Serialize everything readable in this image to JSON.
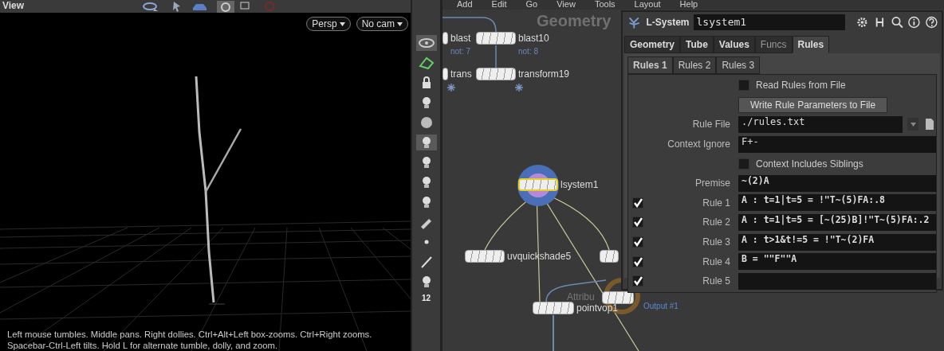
{
  "viewer": {
    "title": "View",
    "camera_menus": [
      "Persp",
      "No cam"
    ],
    "help_text": "Left mouse tumbles. Middle pans. Right dollies. Ctrl+Alt+Left box-zooms. Ctrl+Right zooms. Spacebar-Ctrl-Left tilts. Hold L for alternate tumble, dolly, and zoom."
  },
  "tool_shelf": {
    "badge": "12"
  },
  "network": {
    "menu": [
      "Add",
      "Edit",
      "Go",
      "View",
      "Tools",
      "Layout",
      "Help"
    ],
    "context_label": "Geometry",
    "output_label": "Output #1",
    "nodes": [
      {
        "kind": "plain",
        "name": "blast",
        "note": "not: 7",
        "selected": false,
        "display": false
      },
      {
        "kind": "plain",
        "name": "blast10",
        "note": "not: 8",
        "selected": false,
        "display": false
      },
      {
        "kind": "frozen",
        "name": "trans",
        "selected": false,
        "display": false
      },
      {
        "kind": "frozen",
        "name": "transform19",
        "selected": false,
        "display": false
      },
      {
        "kind": "plain",
        "name": "lsystem1",
        "selected": true,
        "display": true
      },
      {
        "kind": "plain",
        "name": "uvquickshade5",
        "selected": false,
        "display": false
      },
      {
        "kind": "plain",
        "selected": false,
        "display": false
      },
      {
        "kind": "plain",
        "name": "Attribu",
        "selected": false,
        "display": false
      },
      {
        "kind": "plain",
        "name": "pointvop1",
        "selected": false,
        "display": false
      }
    ]
  },
  "parameters": {
    "node_type": "L-System",
    "node_name": "lsystem1",
    "tabs": [
      {
        "label": "Geometry",
        "selected": false,
        "disabled": false
      },
      {
        "label": "Tube",
        "selected": false,
        "disabled": false
      },
      {
        "label": "Values",
        "selected": false,
        "disabled": false
      },
      {
        "label": "Funcs",
        "selected": false,
        "disabled": true
      },
      {
        "label": "Rules",
        "selected": true,
        "disabled": false
      }
    ],
    "subtabs": [
      {
        "label": "Rules 1",
        "selected": true
      },
      {
        "label": "Rules 2",
        "selected": false
      },
      {
        "label": "Rules 3",
        "selected": false
      }
    ],
    "rows": [
      {
        "kind": "checkbox",
        "label": "Read Rules from File",
        "checked": false
      },
      {
        "kind": "button",
        "label": "Write Rule Parameters to File"
      },
      {
        "kind": "file",
        "label": "Rule File",
        "value": "./rules.txt"
      },
      {
        "kind": "text",
        "label": "Context Ignore",
        "value": "F+-"
      },
      {
        "kind": "checkbox",
        "label": "Context Includes Siblings",
        "checked": false
      },
      {
        "kind": "text",
        "label": "Premise",
        "value": "~(2)A"
      },
      {
        "kind": "rule",
        "label": "Rule 1",
        "value": "A : t=1|t=5 = !\"T~(5)FA:.8",
        "checked": true
      },
      {
        "kind": "rule",
        "label": "Rule 2",
        "value": "A : t=1|t=5 = [~(25)B]!\"T~(5)FA:.2",
        "checked": true
      },
      {
        "kind": "rule",
        "label": "Rule 3",
        "value": "A : t>1&t!=5 = !\"T~(2)FA",
        "checked": true
      },
      {
        "kind": "rule",
        "label": "Rule 4",
        "value": "B = \"\"F\"\"A",
        "checked": true
      },
      {
        "kind": "rule",
        "label": "Rule 5",
        "value": "",
        "checked": true
      }
    ]
  }
}
